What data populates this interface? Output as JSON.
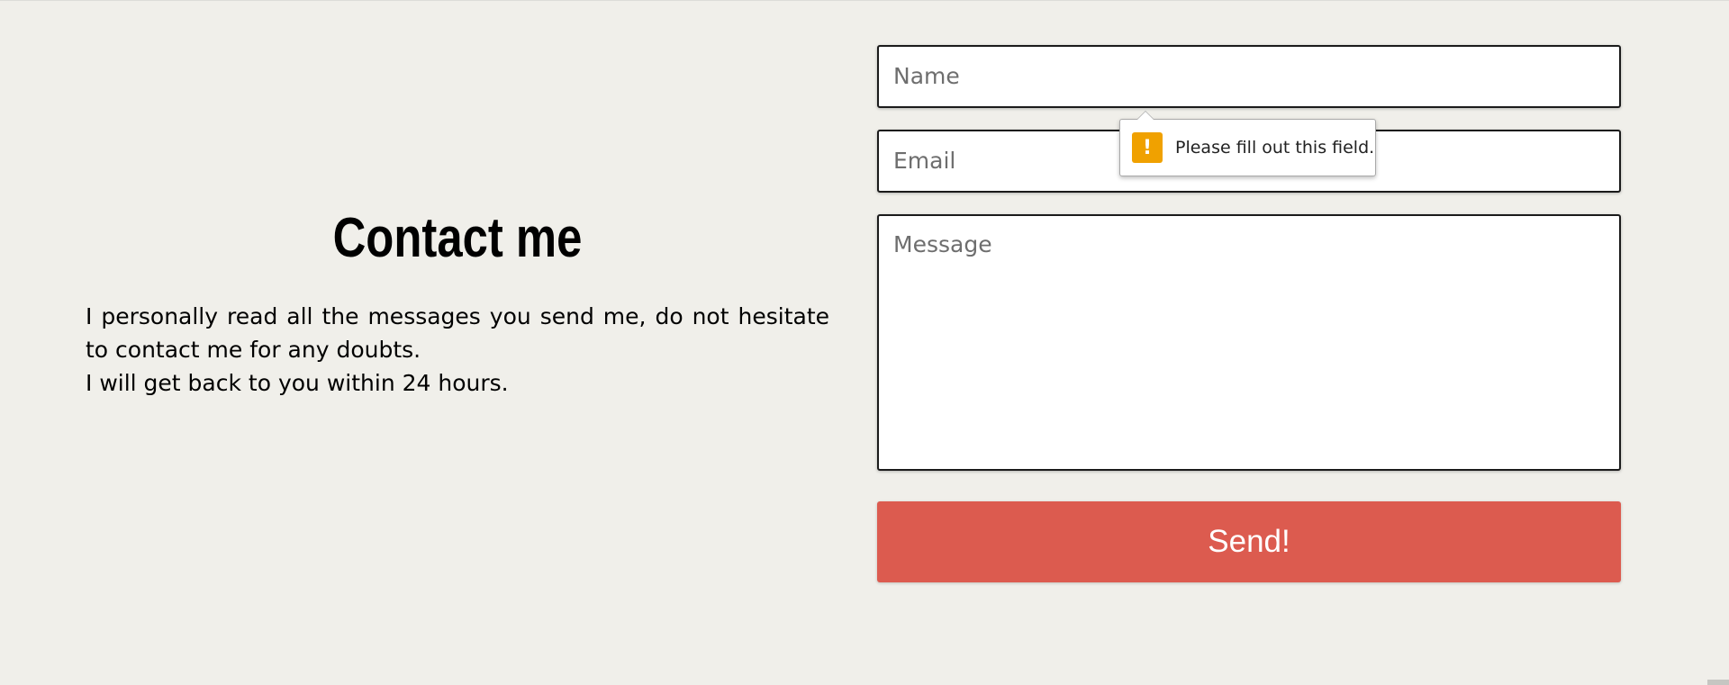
{
  "contact": {
    "title": "Contact me",
    "intro_line1": "I personally read all the messages you send me, do not hesitate to contact me for any doubts.",
    "intro_line2": "I will get back to you within 24 hours."
  },
  "form": {
    "name_placeholder": "Name",
    "email_placeholder": "Email",
    "message_placeholder": "Message",
    "send_label": "Send!"
  },
  "tooltip": {
    "text": "Please fill out this field.",
    "icon": "warning-icon",
    "icon_glyph": "!"
  },
  "colors": {
    "background": "#f0efea",
    "accent_button": "#dc5b4f",
    "warning": "#f0a100"
  }
}
